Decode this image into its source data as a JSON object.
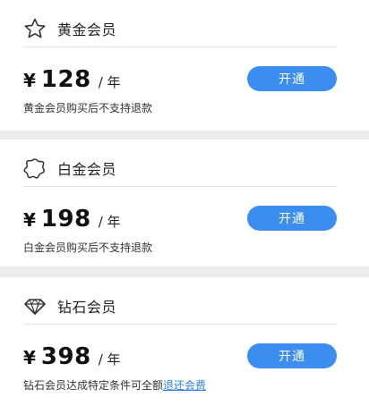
{
  "plans": [
    {
      "icon": "star-outline-icon",
      "title": "黄金会员",
      "currency": "¥",
      "price": "128",
      "unit": "/ 年",
      "note": "黄金会员购买后不支持退款",
      "note_link": "",
      "button": "开通"
    },
    {
      "icon": "badge-outline-icon",
      "title": "白金会员",
      "currency": "¥",
      "price": "198",
      "unit": "/ 年",
      "note": "白金会员购买后不支持退款",
      "note_link": "",
      "button": "开通"
    },
    {
      "icon": "diamond-outline-icon",
      "title": "钻石会员",
      "currency": "¥",
      "price": "398",
      "unit": "/ 年",
      "note": "钻石会员达成特定条件可全额",
      "note_link": "退还会费",
      "button": "开通"
    }
  ],
  "colors": {
    "button_bg": "#3b8ef0",
    "link": "#2f80ed",
    "separator": "#ededf0"
  }
}
